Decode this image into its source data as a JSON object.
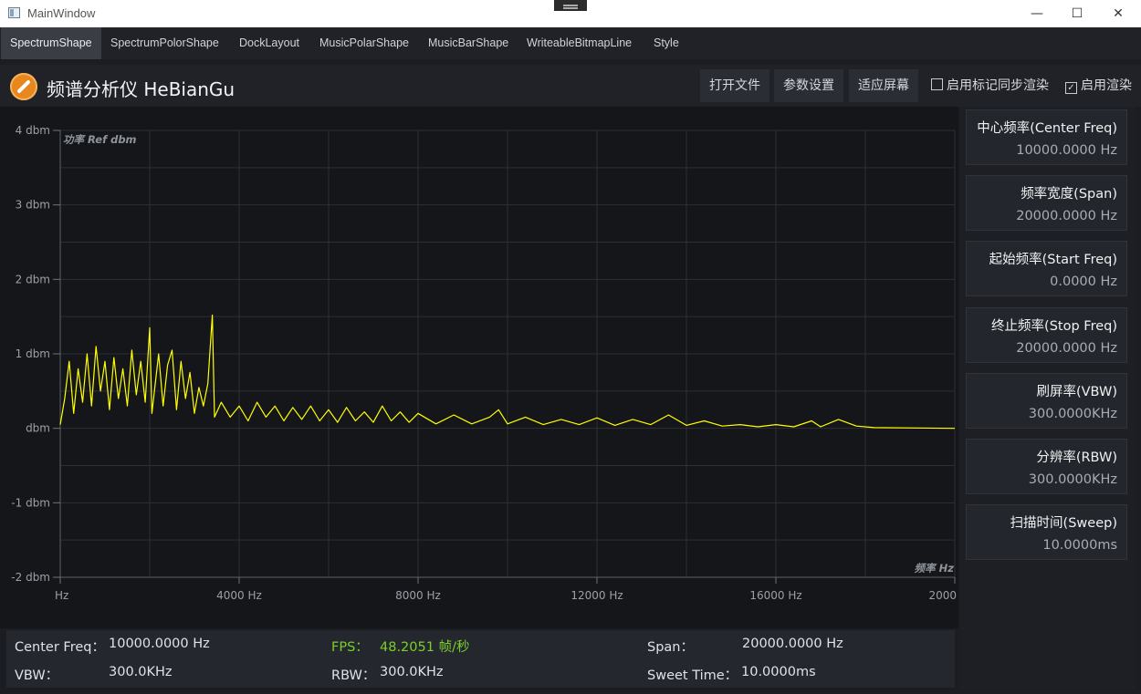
{
  "window": {
    "title": "MainWindow",
    "minimize_glyph": "—",
    "maximize_glyph": "☐",
    "close_glyph": "✕"
  },
  "tabs": [
    {
      "label": "SpectrumShape",
      "active": true
    },
    {
      "label": "SpectrumPolorShape",
      "active": false
    },
    {
      "label": "DockLayout",
      "active": false
    },
    {
      "label": "MusicPolarShape",
      "active": false
    },
    {
      "label": "MusicBarShape",
      "active": false
    },
    {
      "label": "WriteableBitmapLine",
      "active": false
    },
    {
      "label": "Style",
      "active": false
    }
  ],
  "header": {
    "title": "频谱分析仪 HeBianGu",
    "buttons": [
      "打开文件",
      "参数设置",
      "适应屏幕"
    ],
    "checkboxes": [
      {
        "label": "启用标记同步渲染",
        "checked": false
      },
      {
        "label": "启用渲染",
        "checked": true
      }
    ]
  },
  "side_panel": [
    {
      "label": "中心频率(Center Freq)",
      "value": "10000.0000 Hz"
    },
    {
      "label": "频率宽度(Span)",
      "value": "20000.0000 Hz"
    },
    {
      "label": "起始频率(Start Freq)",
      "value": "0.0000 Hz"
    },
    {
      "label": "终止频率(Stop Freq)",
      "value": "20000.0000 Hz"
    },
    {
      "label": "刷屏率(VBW)",
      "value": "300.0000KHz"
    },
    {
      "label": "分辨率(RBW)",
      "value": "300.0000KHz"
    },
    {
      "label": "扫描时间(Sweep)",
      "value": "10.0000ms"
    }
  ],
  "status": {
    "center_freq_label": "Center Freq：",
    "center_freq_value": "10000.0000 Hz",
    "fps_label": "FPS：",
    "fps_value": "48.2051 帧/秒",
    "span_label": "Span：",
    "span_value": "20000.0000 Hz",
    "vbw_label": "VBW：",
    "vbw_value": "300.0KHz",
    "rbw_label": "RBW：",
    "rbw_value": "300.0KHz",
    "sweep_label": "Sweet Time：",
    "sweep_value": "10.0000ms"
  },
  "colors": {
    "trace": "#ffff00",
    "fps": "#7bcf2b",
    "grid": "#2c2f35"
  },
  "chart_data": {
    "type": "line",
    "y_axis_title": "功率 Ref dbm",
    "x_axis_title": "频率 Hz",
    "xlim": [
      0,
      20000
    ],
    "ylim": [
      -2,
      4
    ],
    "x_ticks": [
      {
        "value": 0,
        "label": "Hz"
      },
      {
        "value": 4000,
        "label": "4000 Hz"
      },
      {
        "value": 8000,
        "label": "8000 Hz"
      },
      {
        "value": 12000,
        "label": "12000 Hz"
      },
      {
        "value": 16000,
        "label": "16000 Hz"
      },
      {
        "value": 20000,
        "label": "2000"
      }
    ],
    "y_ticks": [
      {
        "value": 4,
        "label": "4 dbm"
      },
      {
        "value": 3,
        "label": "3 dbm"
      },
      {
        "value": 2,
        "label": "2 dbm"
      },
      {
        "value": 1,
        "label": "1 dbm"
      },
      {
        "value": 0,
        "label": "dbm"
      },
      {
        "value": -1,
        "label": "-1 dbm"
      },
      {
        "value": -2,
        "label": "-2 dbm"
      }
    ],
    "grid": true,
    "series": [
      {
        "values": [
          [
            0,
            0.05
          ],
          [
            100,
            0.4
          ],
          [
            200,
            0.9
          ],
          [
            300,
            0.2
          ],
          [
            400,
            0.8
          ],
          [
            500,
            0.35
          ],
          [
            600,
            1.0
          ],
          [
            700,
            0.3
          ],
          [
            800,
            1.1
          ],
          [
            900,
            0.5
          ],
          [
            1000,
            0.9
          ],
          [
            1100,
            0.25
          ],
          [
            1200,
            0.95
          ],
          [
            1300,
            0.4
          ],
          [
            1400,
            0.8
          ],
          [
            1500,
            0.3
          ],
          [
            1600,
            1.05
          ],
          [
            1700,
            0.45
          ],
          [
            1800,
            0.9
          ],
          [
            1900,
            0.35
          ],
          [
            2000,
            1.35
          ],
          [
            2050,
            0.2
          ],
          [
            2200,
            1.0
          ],
          [
            2300,
            0.3
          ],
          [
            2400,
            0.85
          ],
          [
            2500,
            1.05
          ],
          [
            2600,
            0.25
          ],
          [
            2700,
            0.9
          ],
          [
            2800,
            0.4
          ],
          [
            2900,
            0.75
          ],
          [
            3000,
            0.2
          ],
          [
            3100,
            0.55
          ],
          [
            3200,
            0.3
          ],
          [
            3300,
            0.6
          ],
          [
            3400,
            1.52
          ],
          [
            3450,
            0.15
          ],
          [
            3600,
            0.35
          ],
          [
            3800,
            0.15
          ],
          [
            4000,
            0.3
          ],
          [
            4200,
            0.1
          ],
          [
            4400,
            0.35
          ],
          [
            4600,
            0.15
          ],
          [
            4800,
            0.3
          ],
          [
            5000,
            0.1
          ],
          [
            5200,
            0.28
          ],
          [
            5400,
            0.12
          ],
          [
            5600,
            0.3
          ],
          [
            5800,
            0.1
          ],
          [
            6000,
            0.25
          ],
          [
            6200,
            0.08
          ],
          [
            6400,
            0.28
          ],
          [
            6600,
            0.1
          ],
          [
            6800,
            0.22
          ],
          [
            7000,
            0.08
          ],
          [
            7200,
            0.3
          ],
          [
            7400,
            0.1
          ],
          [
            7600,
            0.22
          ],
          [
            7800,
            0.08
          ],
          [
            8000,
            0.2
          ],
          [
            8400,
            0.06
          ],
          [
            8800,
            0.18
          ],
          [
            9200,
            0.06
          ],
          [
            9600,
            0.15
          ],
          [
            9800,
            0.25
          ],
          [
            10000,
            0.06
          ],
          [
            10400,
            0.15
          ],
          [
            10800,
            0.05
          ],
          [
            11200,
            0.12
          ],
          [
            11600,
            0.05
          ],
          [
            12000,
            0.14
          ],
          [
            12400,
            0.04
          ],
          [
            12800,
            0.12
          ],
          [
            13200,
            0.05
          ],
          [
            13600,
            0.18
          ],
          [
            14000,
            0.04
          ],
          [
            14400,
            0.1
          ],
          [
            14800,
            0.03
          ],
          [
            15200,
            0.05
          ],
          [
            15600,
            0.02
          ],
          [
            16000,
            0.05
          ],
          [
            16400,
            0.02
          ],
          [
            16800,
            0.1
          ],
          [
            17000,
            0.02
          ],
          [
            17400,
            0.12
          ],
          [
            17800,
            0.03
          ],
          [
            18200,
            0.01
          ],
          [
            20000,
            0.0
          ]
        ]
      }
    ]
  }
}
